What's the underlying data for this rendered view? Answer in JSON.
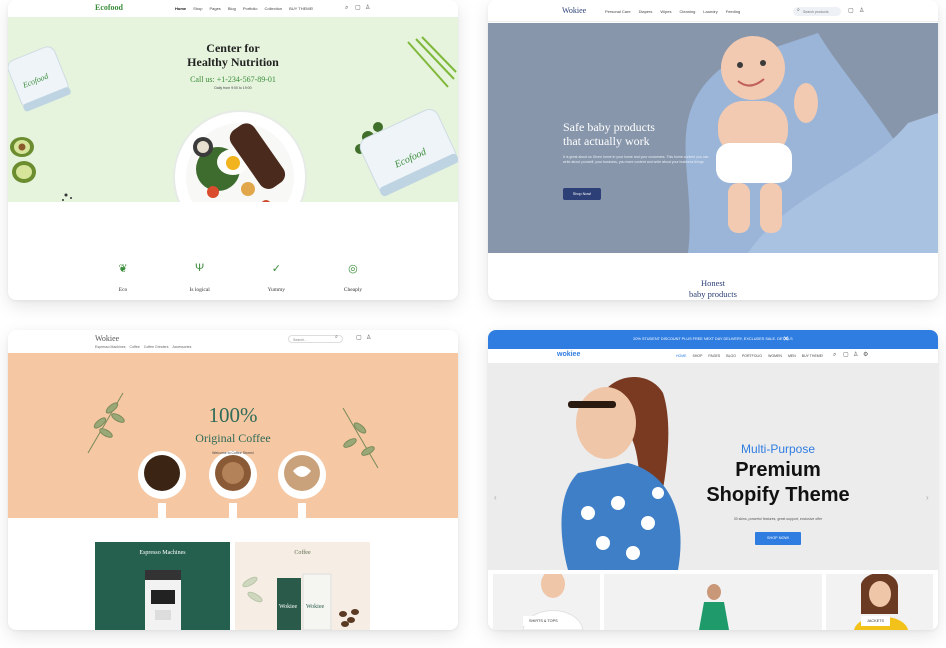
{
  "card1": {
    "logo": "Ecofood",
    "nav": [
      "Home",
      "Shop",
      "Pages",
      "Blog",
      "Portfolio",
      "Collection",
      "BUY THEME!"
    ],
    "title_line1": "Center for",
    "title_line2": "Healthy Nutrition",
    "phone": "Call us: +1-234-567-89-01",
    "hours": "Daily from 9:00 to 19:00",
    "box_brand": "Ecofood",
    "features": [
      {
        "label": "Eco",
        "icon": "leaf-icon"
      },
      {
        "label": "Is logical",
        "icon": "cutlery-icon"
      },
      {
        "label": "Yummy",
        "icon": "thumbs-up-icon"
      },
      {
        "label": "Cheaply",
        "icon": "money-icon"
      }
    ]
  },
  "card2": {
    "logo": "Wokiee",
    "nav": [
      "Personal Care",
      "Diapers",
      "Wipes",
      "Cleaning",
      "Laundry",
      "Feeding"
    ],
    "search_placeholder": "Search products",
    "title_line1": "Safe baby products",
    "title_line2": "that actually work",
    "body": "It is great about us Given home in your home and your customers. This home content you can write about yourself, your business, you more content and write about your business things.",
    "button": "Shop Now!",
    "below_line1": "Honest",
    "below_line2": "baby products"
  },
  "card3": {
    "logo": "Wokiee",
    "nav": [
      "Espresso Machines",
      "Coffee",
      "Coffee Grinders",
      "Accessories"
    ],
    "search_placeholder": "Search...",
    "big": "100%",
    "sub": "Original Coffee",
    "welcome": "Welcome to Coffee Stores!",
    "tile_a": "Espresso Machines",
    "tile_b": "Coffee",
    "bag_label": "Wokiee"
  },
  "card4": {
    "promo": "20% STUDENT DISCOUNT PLUS FREE NEXT DAY DELIVERY, EXCLUDES SALE. DETAILS",
    "logo": "wokiee",
    "nav": [
      "HOME",
      "SHOP",
      "PAGES",
      "BLOG",
      "PORTFOLIO",
      "WOMEN",
      "MEN",
      "BUY THEME!"
    ],
    "title_multi": "Multi-Purpose",
    "title_premium": "Premium",
    "title_shopify": "Shopify Theme",
    "desc": "30 skins, powerful features, great support, exclusive offer",
    "button": "SHOP NOW!",
    "categories": [
      "SHIRTS & TOPS",
      "JACKETS"
    ],
    "colors": {
      "accent": "#2f7de1"
    }
  }
}
